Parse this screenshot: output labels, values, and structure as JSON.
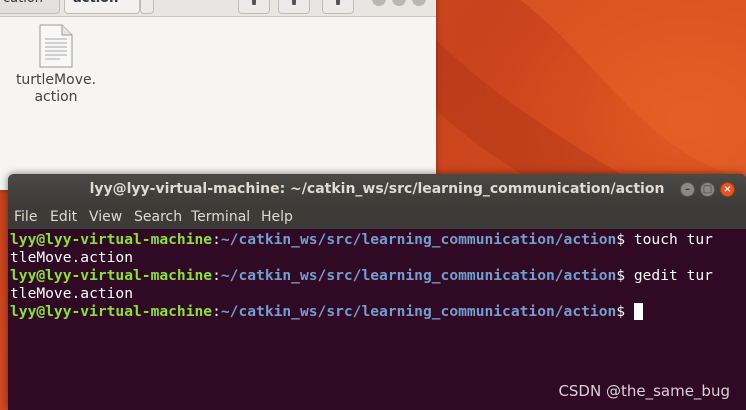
{
  "files_window": {
    "path_prev_label": "cation",
    "path_current_label": "action",
    "file": {
      "name_line1": "turtleMove.",
      "name_line2": "action",
      "icon": "text-file-icon"
    }
  },
  "terminal": {
    "title": "lyy@lyy-virtual-machine: ~/catkin_ws/src/learning_communication/action",
    "controls": [
      "minimize-icon",
      "maximize-icon",
      "close-icon"
    ],
    "menu": [
      "File",
      "Edit",
      "View",
      "Search",
      "Terminal",
      "Help"
    ],
    "lines": [
      {
        "user": "lyy@lyy-virtual-machine",
        "sep": ":",
        "path": "~/catkin_ws/src/learning_communication/action",
        "cmd": "$ touch tur"
      },
      {
        "text": "tleMove.action"
      },
      {
        "user": "lyy@lyy-virtual-machine",
        "sep": ":",
        "path": "~/catkin_ws/src/learning_communication/action",
        "cmd": "$ gedit tur"
      },
      {
        "text": "tleMove.action"
      },
      {
        "user": "lyy@lyy-virtual-machine",
        "sep": ":",
        "path": "~/catkin_ws/src/learning_communication/action",
        "cmd": "$ "
      }
    ]
  },
  "watermark": "CSDN @the_same_bug",
  "colors": {
    "terminal_bg": "#300a24",
    "prompt_user": "#8ae234",
    "prompt_path": "#729fcf",
    "accent_close": "#e95420"
  }
}
